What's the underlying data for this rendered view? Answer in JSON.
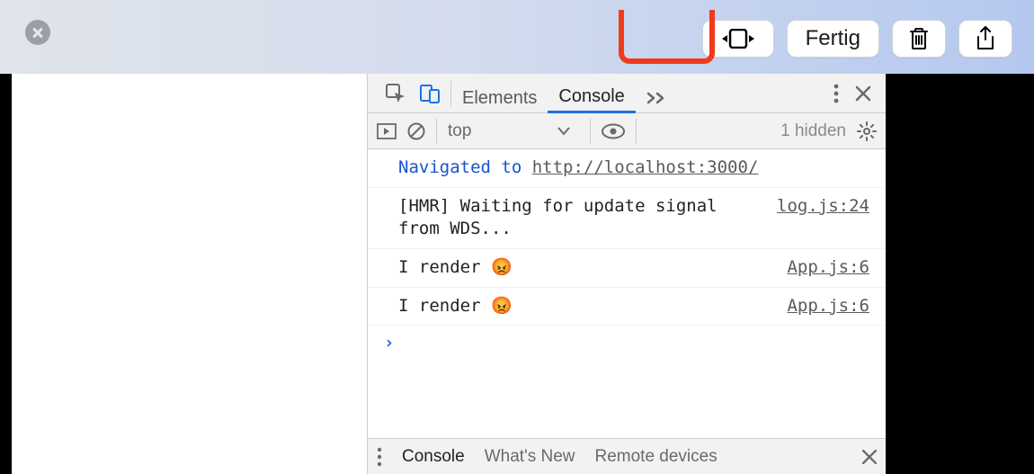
{
  "topbar": {
    "done_label": "Fertig"
  },
  "devtools": {
    "tabs": {
      "elements": "Elements",
      "console": "Console"
    },
    "toolbar": {
      "context": "top",
      "hidden": "1 hidden"
    },
    "drawer": {
      "console": "Console",
      "whatsnew": "What's New",
      "remote": "Remote devices"
    }
  },
  "console": {
    "nav_label": "Navigated to ",
    "nav_url": "http://localhost:3000/",
    "logs": [
      {
        "msg": "[HMR] Waiting for update signal from WDS...",
        "src": "log.js:24"
      },
      {
        "msg": "I render 😡",
        "src": "App.js:6"
      },
      {
        "msg": "I render 😡",
        "src": "App.js:6"
      }
    ],
    "prompt": "›"
  }
}
